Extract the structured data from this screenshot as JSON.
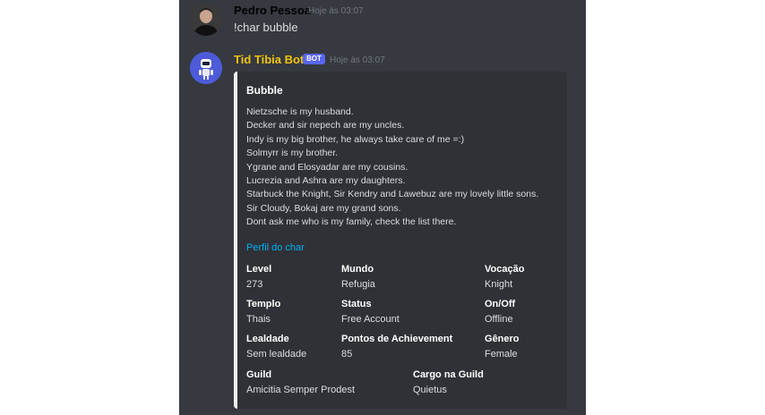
{
  "messages": [
    {
      "author": "Pedro Pessoa",
      "author_color": "#dcddde",
      "timestamp": "Hoje às 03:07",
      "content": "!char bubble"
    },
    {
      "author": "Tid Tibia Bot",
      "author_color": "#f1c40f",
      "bot_tag": "BOT",
      "timestamp": "Hoje às 03:07"
    }
  ],
  "embed": {
    "accent_color": "#ecf0f1",
    "title": "Bubble",
    "description_lines": [
      "Nietzsche is my husband.",
      "Decker and sir nepech are my uncles.",
      "Indy is my big brother, he always take care of me =:)",
      "Solmyrr is my brother.",
      "Ygrane and Elosyadar are my cousins.",
      "Lucrezia and Ashra are my daughters.",
      "Starbuck the Knight, Sir Kendry and Lawebuz are my lovely little sons.",
      "Sir Cloudy, Bokaj are my grand sons.",
      "Dont ask me who is my family, check the list there."
    ],
    "link_text": "Perfil do char",
    "fields": [
      {
        "name": "Level",
        "value": "273"
      },
      {
        "name": "Mundo",
        "value": "Refugia"
      },
      {
        "name": "Vocação",
        "value": "Knight"
      },
      {
        "name": "Templo",
        "value": "Thais"
      },
      {
        "name": "Status",
        "value": "Free Account"
      },
      {
        "name": "On/Off",
        "value": "Offline"
      },
      {
        "name": "Lealdade",
        "value": "Sem lealdade"
      },
      {
        "name": "Pontos de Achievement",
        "value": "85"
      },
      {
        "name": "Gênero",
        "value": "Female"
      },
      {
        "name": "Guild",
        "value": "Amicitia Semper Prodest"
      },
      {
        "name": "Cargo na Guild",
        "value": "Quietus"
      }
    ]
  }
}
